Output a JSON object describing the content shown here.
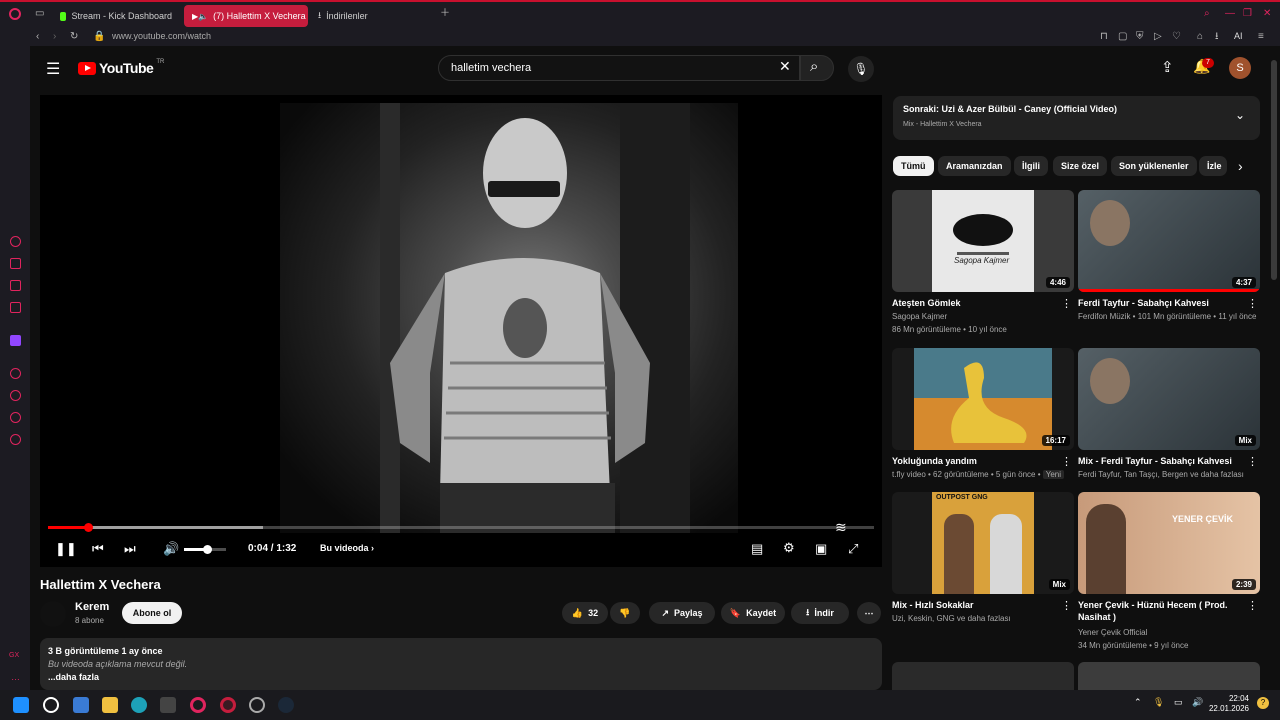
{
  "browser": {
    "tabs": [
      {
        "label": "Stream - Kick Dashboard"
      },
      {
        "label": "(7) Hallettim X Vechera"
      },
      {
        "label": "İndirilenler"
      }
    ],
    "url": "www.youtube.com/watch",
    "ai_label": "AI"
  },
  "youtube": {
    "logo_text": "YouTube",
    "region": "TR",
    "search_value": "halletim vechera",
    "notification_count": "7",
    "avatar_letter": "S"
  },
  "player": {
    "time": "0:04 / 1:32",
    "chapter_label": "Bu videoda",
    "progress": 0.048,
    "volume_level": 0.55
  },
  "video": {
    "title": "Hallettim X Vechera",
    "channel": "Kerem",
    "subscribers": "8 abone",
    "subscribe_label": "Abone ol",
    "like_count": "32",
    "share_label": "Paylaş",
    "save_label": "Kaydet",
    "download_label": "İndir",
    "views_date": "3 B görüntüleme  1 ay önce",
    "description": "Bu videoda açıklama mevcut değil.",
    "more_label": "...daha fazla"
  },
  "next_up": {
    "title": "Sonraki: Uzi & Azer Bülbül - Caney (Official Video)",
    "subtitle": "Mix - Hallettim X Vechera"
  },
  "chips": [
    "Tümü",
    "Aramanızdan",
    "İlgili",
    "Size özel",
    "Son yüklenenler",
    "İzle"
  ],
  "recommendations": [
    {
      "title": "Ateşten Gömlek",
      "channel": "Sagopa Kajmer",
      "meta": "86 Mn görüntüleme • 10 yıl önce",
      "duration": "4:46",
      "thumb_text": "Sagopa Kajmer"
    },
    {
      "title": "Ferdi Tayfur - Sabahçı Kahvesi",
      "channel": "Ferdifon Müzik • 101 Mn görüntüleme • 11 yıl önce",
      "meta": "",
      "duration": "4:37",
      "thumb_text": ""
    },
    {
      "title": "Yokluğunda yandım",
      "channel": "t.fly video • 62 görüntüleme • 5 gün önce •",
      "badge": "Yeni",
      "meta": "",
      "duration": "16:17",
      "thumb_text": ""
    },
    {
      "title": "Mix - Ferdi Tayfur - Sabahçı Kahvesi",
      "channel": "Ferdi Tayfur, Tan Taşçı, Bergen ve daha fazlası",
      "meta": "",
      "duration": "Mix",
      "thumb_text": ""
    },
    {
      "title": "Mix - Hızlı Sokaklar",
      "channel": "Uzi, Keskin, GNG ve daha fazlası",
      "meta": "",
      "duration": "Mix",
      "thumb_text": "OUTPOST  GNG"
    },
    {
      "title": "Yener Çevik - Hüznü Hecem ( Prod. Nasihat )",
      "channel": "Yener Çevik Official",
      "meta": "34 Mn görüntüleme • 9 yıl önce",
      "duration": "2:39",
      "thumb_text": "YENER ÇEVİK"
    }
  ],
  "taskbar": {
    "time": "22:04",
    "date": "22.01.2026"
  },
  "colors": {
    "accent_red": "#ff0000",
    "opera_red": "#c51d3d",
    "bg": "#0f0f0f"
  }
}
